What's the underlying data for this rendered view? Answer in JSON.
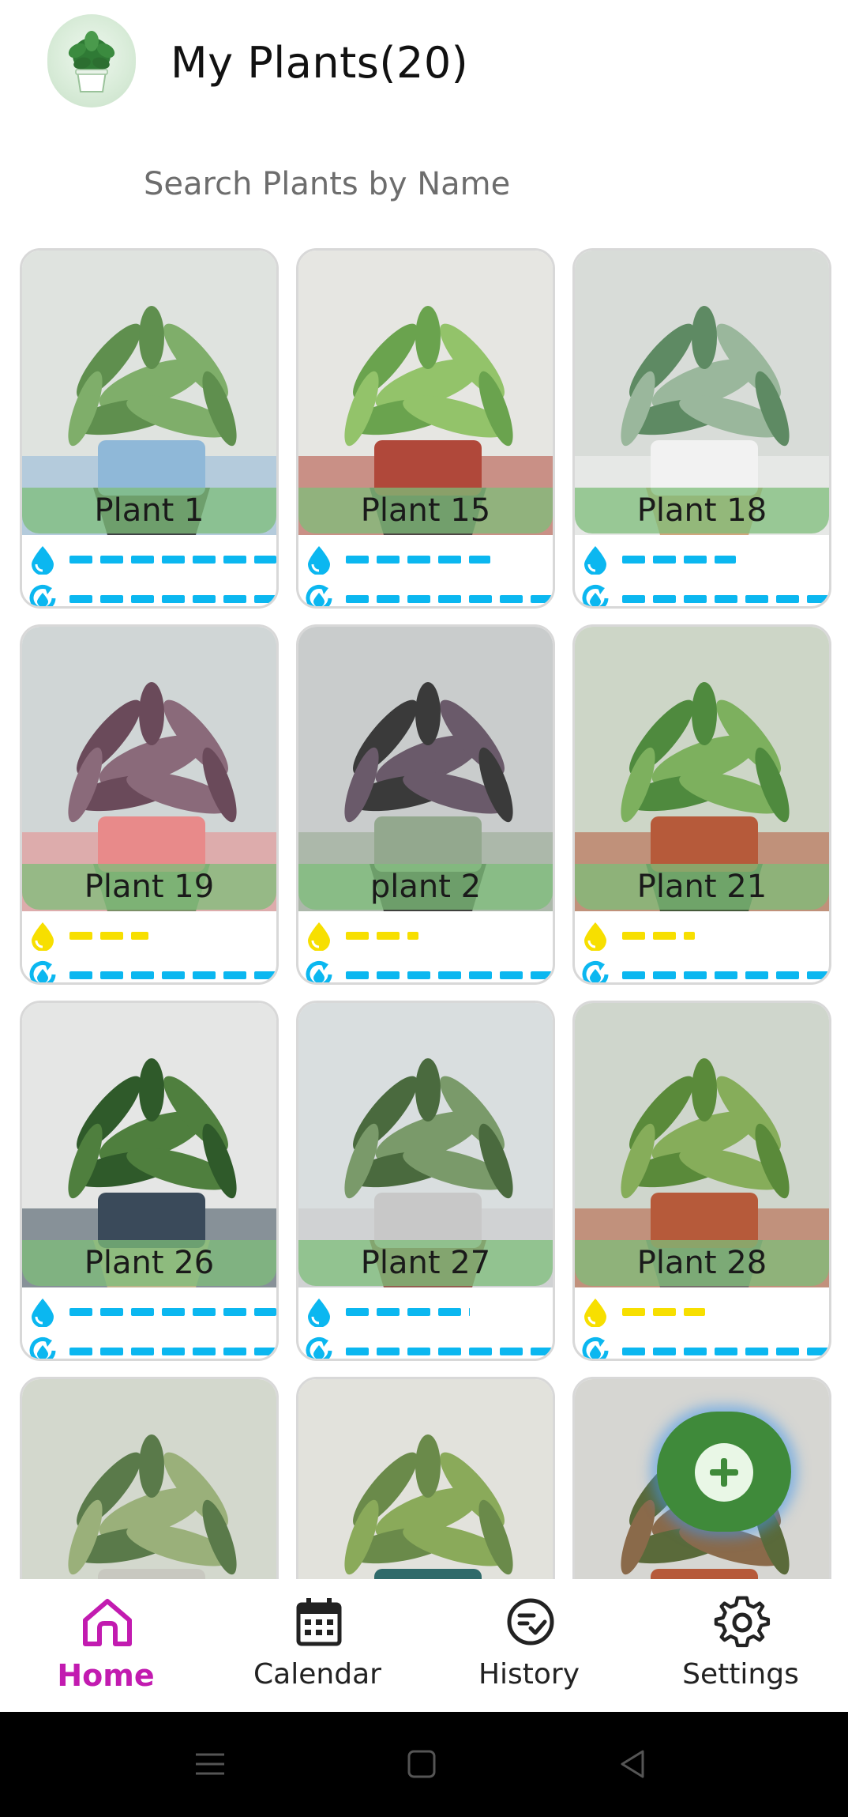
{
  "header": {
    "title": "My Plants(20)"
  },
  "search": {
    "placeholder": "Search Plants by Name"
  },
  "colors": {
    "water_blue": "#0bb7f0",
    "water_yellow": "#f7df00",
    "active_nav": "#c21bb0",
    "name_bar": "#7ebe7a",
    "fab": "#3f8a3a"
  },
  "plants": [
    {
      "name": "Plant 1",
      "water_level": 1.0,
      "water_state": "blue",
      "cycle_level": 1.0
    },
    {
      "name": "Plant 15",
      "water_level": 0.7,
      "water_state": "blue",
      "cycle_level": 1.0
    },
    {
      "name": "Plant 18",
      "water_level": 0.55,
      "water_state": "blue",
      "cycle_level": 1.0
    },
    {
      "name": "Plant 19",
      "water_level": 0.38,
      "water_state": "yellow",
      "cycle_level": 1.0
    },
    {
      "name": "plant 2",
      "water_level": 0.35,
      "water_state": "yellow",
      "cycle_level": 1.0
    },
    {
      "name": "Plant 21",
      "water_level": 0.35,
      "water_state": "yellow",
      "cycle_level": 1.0
    },
    {
      "name": "Plant 26",
      "water_level": 1.0,
      "water_state": "blue",
      "cycle_level": 1.0
    },
    {
      "name": "Plant 27",
      "water_level": 0.6,
      "water_state": "blue",
      "cycle_level": 1.0
    },
    {
      "name": "Plant 28",
      "water_level": 0.4,
      "water_state": "yellow",
      "cycle_level": 1.0
    },
    {
      "name": "",
      "water_level": null,
      "water_state": "blue",
      "cycle_level": null
    },
    {
      "name": "",
      "water_level": null,
      "water_state": "blue",
      "cycle_level": null
    },
    {
      "name": "",
      "water_level": null,
      "water_state": "blue",
      "cycle_level": null
    }
  ],
  "fab": {
    "icon": "plus-icon"
  },
  "nav": {
    "items": [
      {
        "label": "Home",
        "icon": "home-icon",
        "active": true
      },
      {
        "label": "Calendar",
        "icon": "calendar-icon",
        "active": false
      },
      {
        "label": "History",
        "icon": "history-check-icon",
        "active": false
      },
      {
        "label": "Settings",
        "icon": "gear-icon",
        "active": false
      }
    ]
  },
  "system_nav": {
    "icons": [
      "menu-icon",
      "home-square-icon",
      "back-triangle-icon"
    ]
  }
}
